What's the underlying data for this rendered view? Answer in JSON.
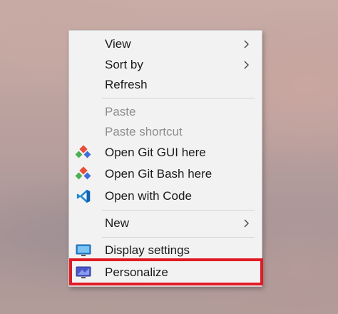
{
  "menu": {
    "items": [
      {
        "label": "View",
        "submenu": true
      },
      {
        "label": "Sort by",
        "submenu": true
      },
      {
        "label": "Refresh"
      },
      {
        "label": "Paste",
        "disabled": true
      },
      {
        "label": "Paste shortcut",
        "disabled": true
      },
      {
        "label": "Open Git GUI here",
        "icon": "git-icon"
      },
      {
        "label": "Open Git Bash here",
        "icon": "git-icon"
      },
      {
        "label": "Open with Code",
        "icon": "vscode-icon"
      },
      {
        "label": "New",
        "submenu": true
      },
      {
        "label": "Display settings",
        "icon": "display-icon"
      },
      {
        "label": "Personalize",
        "icon": "personalize-icon",
        "highlighted": true
      }
    ]
  },
  "colors": {
    "highlight_border": "#e01b24",
    "vscode_blue": "#1f8ad2",
    "git_red": "#e84e3c",
    "git_green": "#4caf50"
  }
}
